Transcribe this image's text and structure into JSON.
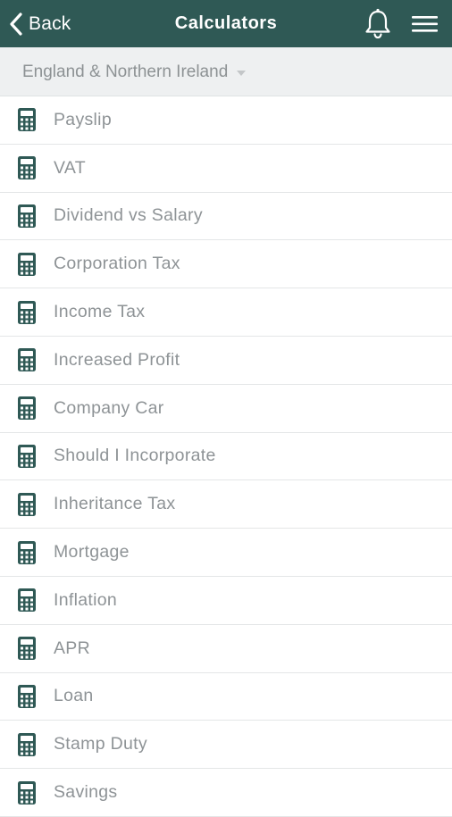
{
  "header": {
    "back_label": "Back",
    "title": "Calculators",
    "background_color": "#2f5955",
    "icons": [
      "chevron-left-icon",
      "bell-icon",
      "hamburger-menu-icon"
    ]
  },
  "region": {
    "selected": "England & Northern Ireland"
  },
  "calculators": [
    {
      "label": "Payslip",
      "icon": "calculator-icon"
    },
    {
      "label": "VAT",
      "icon": "calculator-icon"
    },
    {
      "label": "Dividend vs Salary",
      "icon": "calculator-icon"
    },
    {
      "label": "Corporation Tax",
      "icon": "calculator-icon"
    },
    {
      "label": "Income Tax",
      "icon": "calculator-icon"
    },
    {
      "label": "Increased Profit",
      "icon": "calculator-icon"
    },
    {
      "label": "Company Car",
      "icon": "calculator-icon"
    },
    {
      "label": "Should I Incorporate",
      "icon": "calculator-icon"
    },
    {
      "label": "Inheritance Tax",
      "icon": "calculator-icon"
    },
    {
      "label": "Mortgage",
      "icon": "calculator-icon"
    },
    {
      "label": "Inflation",
      "icon": "calculator-icon"
    },
    {
      "label": "APR",
      "icon": "calculator-icon"
    },
    {
      "label": "Loan",
      "icon": "calculator-icon"
    },
    {
      "label": "Stamp Duty",
      "icon": "calculator-icon"
    },
    {
      "label": "Savings",
      "icon": "calculator-icon"
    }
  ]
}
